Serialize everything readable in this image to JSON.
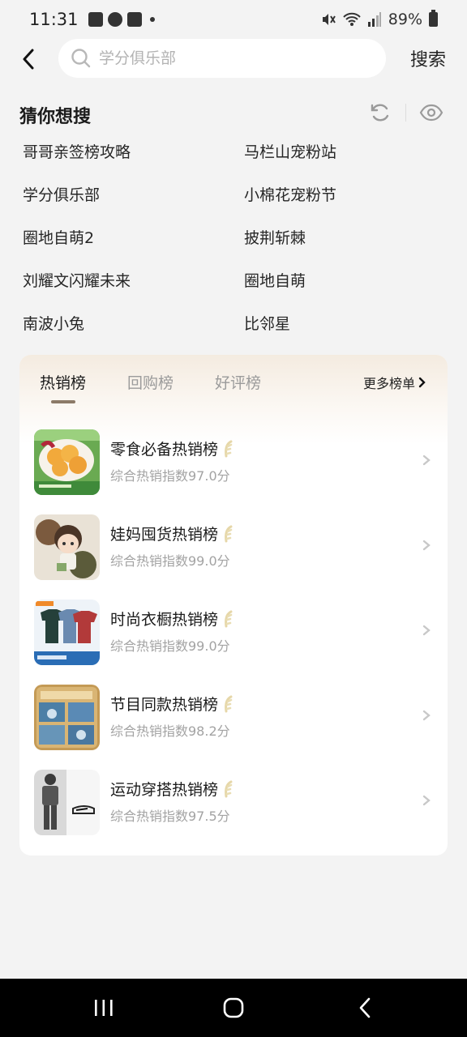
{
  "status_bar": {
    "time": "11:31",
    "battery": "89%",
    "left_icons": [
      "gallery-icon",
      "leaf-icon",
      "check-icon",
      "dot-icon"
    ],
    "right_icons": [
      "mute-icon",
      "wifi-icon",
      "signal-icon",
      "battery-icon"
    ]
  },
  "search": {
    "placeholder": "学分俱乐部",
    "value": "",
    "submit_label": "搜索"
  },
  "guess": {
    "title": "猜你想搜",
    "items": [
      "哥哥亲签榜攻略",
      "马栏山宠粉站",
      "学分俱乐部",
      "小棉花宠粉节",
      "圈地自萌2",
      "披荆斩棘",
      "刘耀文闪耀未来",
      "圈地自萌",
      "南波小兔",
      "比邻星"
    ]
  },
  "ranking": {
    "tabs": [
      "热销榜",
      "回购榜",
      "好评榜"
    ],
    "active_tab": 0,
    "more_label": "更多榜单",
    "rows": [
      {
        "title": "零食必备热销榜",
        "subtitle": "综合热销指数97.0分"
      },
      {
        "title": "娃妈囤货热销榜",
        "subtitle": "综合热销指数99.0分"
      },
      {
        "title": "时尚衣橱热销榜",
        "subtitle": "综合热销指数99.0分"
      },
      {
        "title": "节目同款热销榜",
        "subtitle": "综合热销指数98.2分"
      },
      {
        "title": "运动穿搭热销榜",
        "subtitle": "综合热销指数97.5分"
      }
    ]
  },
  "colors": {
    "background": "#f3f3f3",
    "accent_underline": "#8c7a68",
    "nav_bar": "#000000"
  }
}
